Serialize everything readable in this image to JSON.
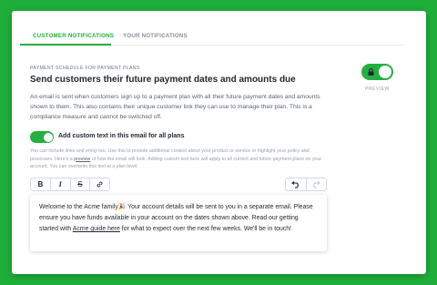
{
  "tabs": [
    {
      "label": "CUSTOMER NOTIFICATIONS",
      "active": true
    },
    {
      "label": "YOUR NOTIFICATIONS",
      "active": false
    }
  ],
  "section_label": "PAYMENT SCHEDULE FOR PAYMENT PLANS",
  "heading": "Send customers their future payment dates and amounts due",
  "description": "An email is sent when customers sign up to a payment plan with all their future payment dates and amounts shown to them. This also contains their unique customer link they can use to manage their plan. This is a compliance measure and cannot be switched off.",
  "main_toggle": {
    "on": true,
    "locked": true,
    "icon": "lock-icon"
  },
  "preview_label": "PREVIEW",
  "custom_text_toggle": {
    "on": true,
    "label": "Add custom text in this email for all plans"
  },
  "help": {
    "before": "You can include links and emoji too. Use this to provide additional context about your product or service or highlight your policy and processes. Here's a ",
    "link": "preview",
    "after": " of how the email will look. Adding custom text here will apply to all current and future payment plans on your account. You can overwrite this text at a plan level."
  },
  "toolbar": {
    "bold": "B",
    "italic": "I",
    "strike": "S",
    "link_icon": "link-icon",
    "undo_icon": "undo-icon",
    "redo_icon": "redo-icon"
  },
  "editor": {
    "before": "Welcome to the Acme family🎉 Your account details will be sent to you in a separate email. Please ensure you have funds available in your account on the dates shown above. Read our getting started with ",
    "link": "Acme guide here",
    "after": " for what to expect over the next few weeks. We'll be in touch!"
  },
  "colors": {
    "accent": "#27ae43",
    "background": "#1fae3a"
  }
}
